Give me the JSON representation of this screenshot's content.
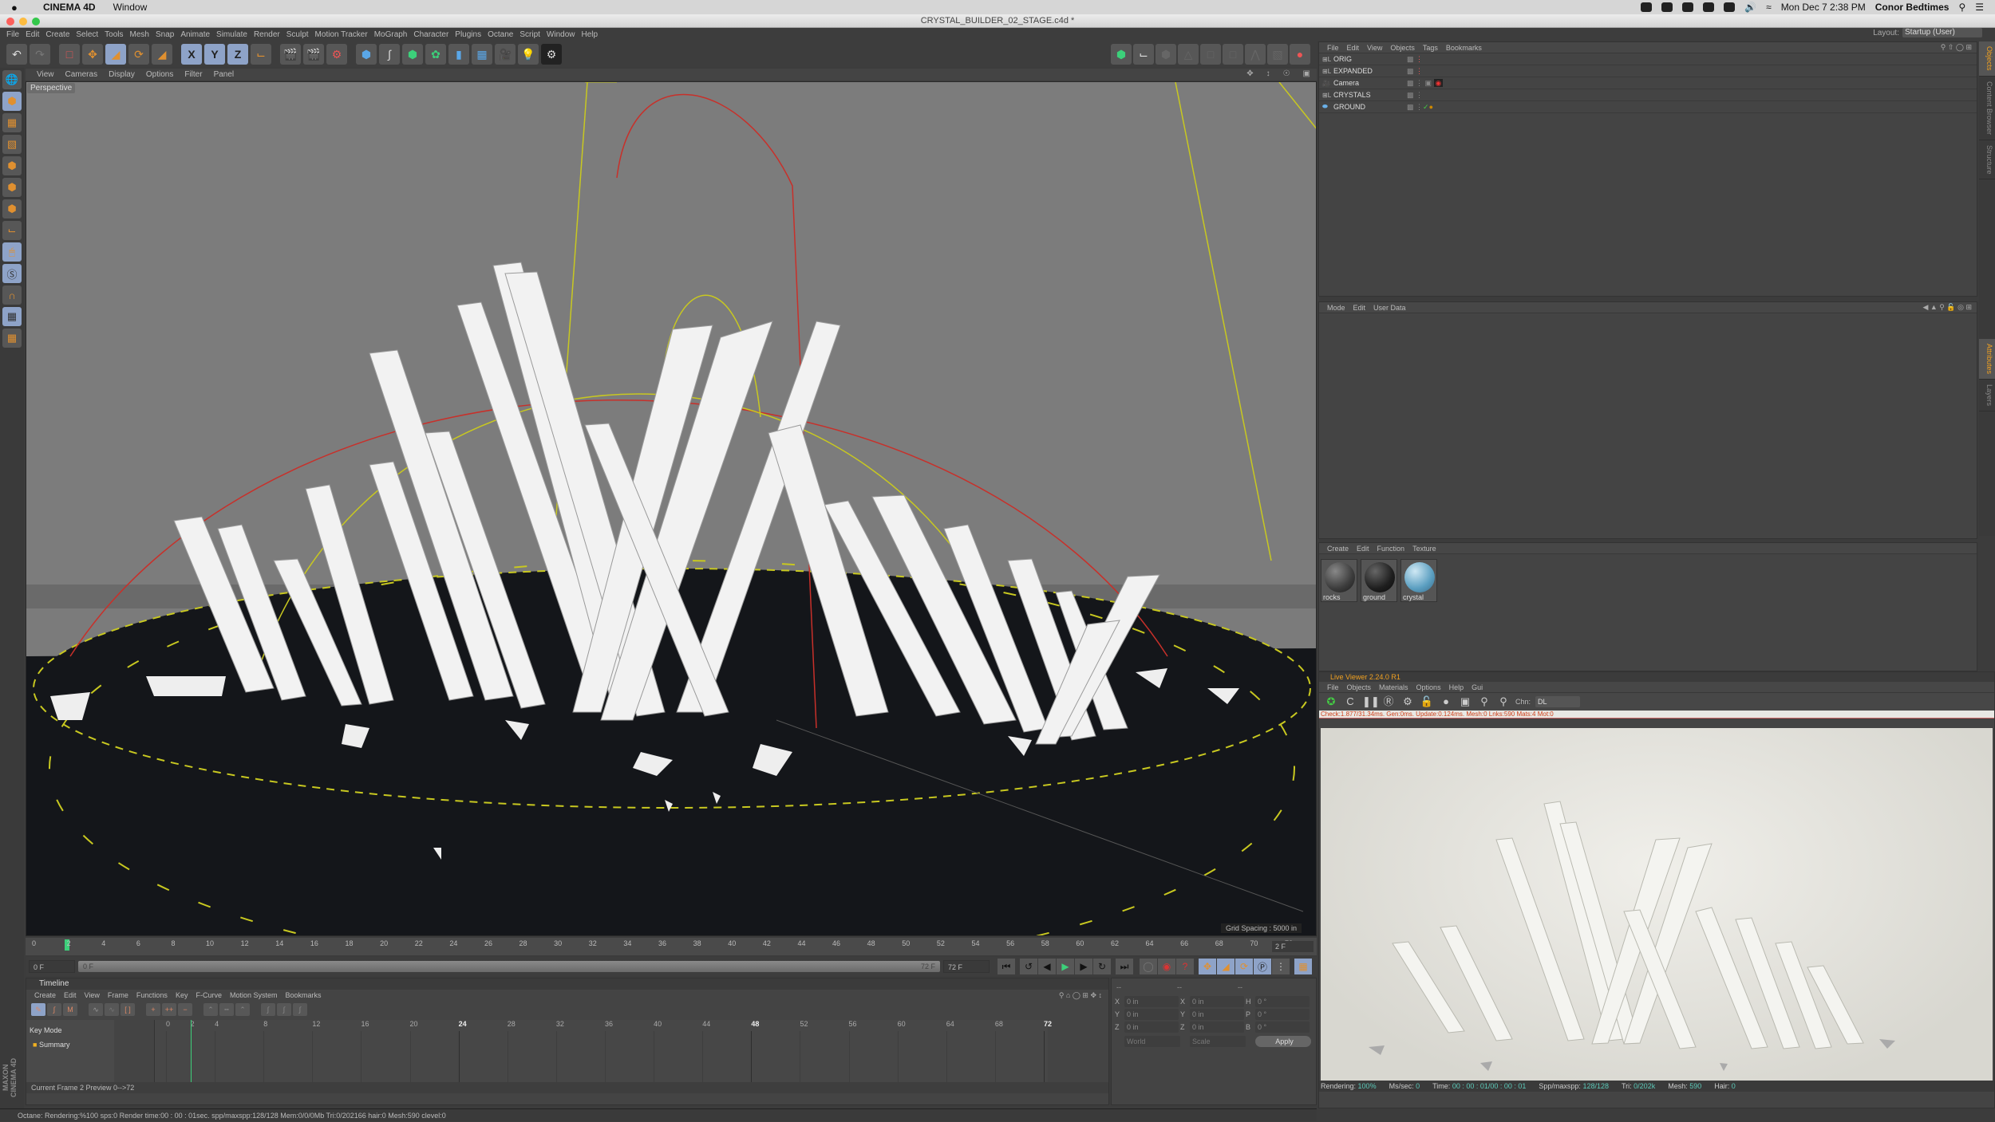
{
  "macos": {
    "app_name": "CINEMA 4D",
    "menu_window": "Window",
    "clock": "Mon Dec 7  2:38 PM",
    "user": "Conor Bedtimes"
  },
  "window": {
    "title": "CRYSTAL_BUILDER_02_STAGE.c4d *"
  },
  "main_menu": [
    "File",
    "Edit",
    "Create",
    "Select",
    "Tools",
    "Mesh",
    "Snap",
    "Animate",
    "Simulate",
    "Render",
    "Sculpt",
    "Motion Tracker",
    "MoGraph",
    "Character",
    "Plugins",
    "Octane",
    "Script",
    "Window",
    "Help"
  ],
  "layout": {
    "label": "Layout:",
    "value": "Startup (User)"
  },
  "toolbar": {
    "icons": [
      "undo-icon",
      "redo-icon",
      "live-selection-icon",
      "move-icon",
      "scale-icon",
      "rotate-icon",
      "last-tool-icon",
      "x-axis-lock-icon",
      "y-axis-lock-icon",
      "z-axis-lock-icon",
      "coordinate-system-icon",
      "render-view-icon",
      "render-picture-queue-icon",
      "edit-render-settings-icon",
      "cube-primitive-icon",
      "spline-pen-icon",
      "subdivision-surface-icon",
      "cloner-icon",
      "deformer-icon",
      "floor-icon",
      "camera-icon",
      "light-icon",
      "octane-settings-icon"
    ],
    "axis_labels": [
      "X",
      "Y",
      "Z"
    ]
  },
  "viewport": {
    "menu": [
      "View",
      "Cameras",
      "Display",
      "Options",
      "Filter",
      "Panel"
    ],
    "camera_label": "Perspective",
    "grid_spacing": "Grid Spacing : 5000 in"
  },
  "ruler": {
    "ticks": [
      "0",
      "2",
      "4",
      "6",
      "8",
      "10",
      "12",
      "14",
      "16",
      "18",
      "20",
      "22",
      "24",
      "26",
      "28",
      "30",
      "32",
      "34",
      "36",
      "38",
      "40",
      "42",
      "44",
      "46",
      "48",
      "50",
      "52",
      "54",
      "56",
      "58",
      "60",
      "62",
      "64",
      "66",
      "68",
      "70",
      "72"
    ],
    "current_frame": "2 F",
    "playhead_frame": 2,
    "max_frame": 72
  },
  "transport": {
    "start_field": "0 F",
    "range_start": "0 F",
    "range_end": "72 F",
    "end_field": "72 F"
  },
  "timeline": {
    "title": "Timeline",
    "menu": [
      "Create",
      "Edit",
      "View",
      "Frame",
      "Functions",
      "Key",
      "F-Curve",
      "Motion System",
      "Bookmarks"
    ],
    "mode_label": "Key Mode",
    "tracks": [
      {
        "label": "Summary"
      }
    ],
    "grid_ticks": [
      "0",
      "2",
      "4",
      "8",
      "12",
      "16",
      "20",
      "24",
      "28",
      "32",
      "36",
      "40",
      "44",
      "48",
      "52",
      "56",
      "60",
      "64",
      "68",
      "72"
    ],
    "major_ticks": [
      "24",
      "48",
      "72"
    ],
    "footer": "Current Frame  2  Preview  0-->72"
  },
  "coordinates": {
    "headers": [
      "--",
      "--",
      "--"
    ],
    "rows": [
      {
        "a": "X",
        "v1": "0 in",
        "b": "X",
        "v2": "0 in",
        "c": "H",
        "v3": "0 °"
      },
      {
        "a": "Y",
        "v1": "0 in",
        "b": "Y",
        "v2": "0 in",
        "c": "P",
        "v3": "0 °"
      },
      {
        "a": "Z",
        "v1": "0 in",
        "b": "Z",
        "v2": "0 in",
        "c": "B",
        "v3": "0 °"
      }
    ],
    "space": "World",
    "mode": "Scale",
    "apply_label": "Apply"
  },
  "status_bar": "Octane: Rendering:%100 sps:0 Render time:00 : 00 : 01sec. spp/maxspp:128/128 Mem:0/0/0Mb Tri:0/202166 hair:0 Mesh:590 clevel:0",
  "objects_panel": {
    "menu": [
      "File",
      "Edit",
      "View",
      "Objects",
      "Tags",
      "Bookmarks"
    ],
    "items": [
      {
        "name": "ORIG",
        "type": "null"
      },
      {
        "name": "EXPANDED",
        "type": "null"
      },
      {
        "name": "Camera",
        "type": "camera"
      },
      {
        "name": "CRYSTALS",
        "type": "null"
      },
      {
        "name": "GROUND",
        "type": "plane"
      }
    ]
  },
  "side_tabs_top": [
    "Objects",
    "Content Browser",
    "Structure"
  ],
  "side_tabs_bottom": [
    "Attributes",
    "Layers"
  ],
  "attributes_panel": {
    "menu": [
      "Mode",
      "Edit",
      "User Data"
    ]
  },
  "materials_panel": {
    "menu": [
      "Create",
      "Edit",
      "Function",
      "Texture"
    ],
    "materials": [
      {
        "name": "rocks",
        "color": "#3c3c3c"
      },
      {
        "name": "ground",
        "color": "#1e1e1e"
      },
      {
        "name": "crystal",
        "color": "#5a9ec0"
      }
    ]
  },
  "live_viewer": {
    "title": "Live Viewer 2.24.0 R1",
    "menu": [
      "File",
      "Objects",
      "Materials",
      "Options",
      "Help",
      "Gui"
    ],
    "channel_label": "Chn:",
    "channel_value": "DL",
    "check_line": "Check:1.877/31.34ms. Gen:0ms. Update:0.124ms. Mesh:0 Lnks:590 Mats:4 Mot:0",
    "status": {
      "rendering_label": "Rendering:",
      "rendering": "100%",
      "mssec_label": "Ms/sec:",
      "mssec": "0",
      "time_label": "Time:",
      "time": "00 : 00 : 01/00 : 00 : 01",
      "spp_label": "Spp/maxspp:",
      "spp": "128/128",
      "tri_label": "Tri:",
      "tri": "0/202k",
      "mesh_label": "Mesh:",
      "mesh": "590",
      "hair_label": "Hair:",
      "hair": "0"
    }
  },
  "colors": {
    "accent_orange": "#f0a020",
    "active_blue": "#8ea3c8",
    "playhead_green": "#3cd07a",
    "stat_teal": "#5cc8b8",
    "warning_red": "#d0401a"
  }
}
